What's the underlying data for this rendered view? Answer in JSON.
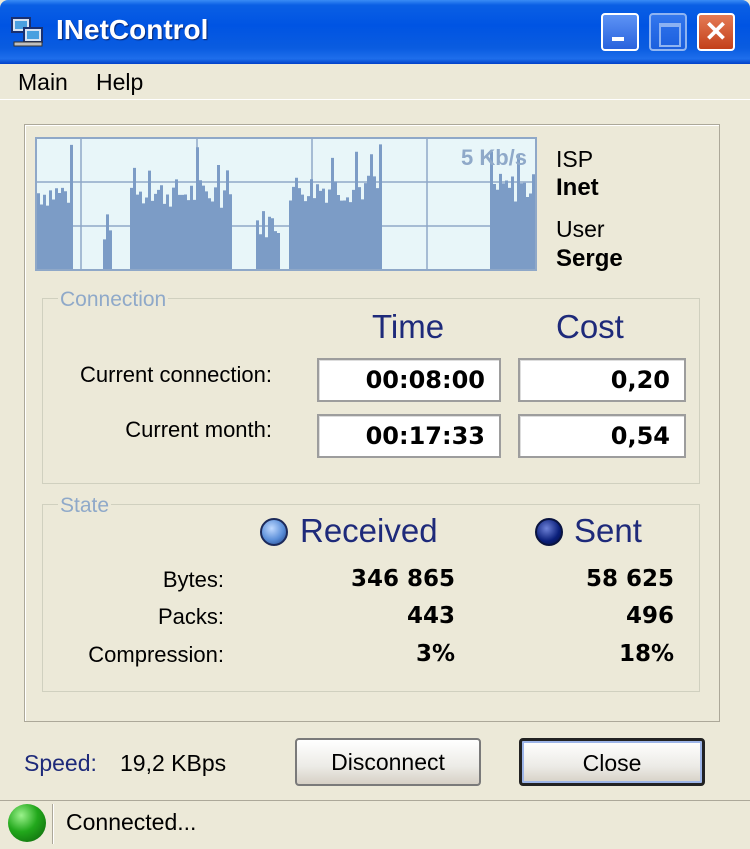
{
  "window": {
    "title": "INetControl"
  },
  "menu": [
    {
      "label": "Main"
    },
    {
      "label": "Help"
    }
  ],
  "graph": {
    "rate_label": "5 Kb/s",
    "fill_color": "#7C9CC6",
    "bg_color": "#E8F6F9"
  },
  "account": {
    "isp_label": "ISP",
    "isp_value": "Inet",
    "user_label": "User",
    "user_value": "Serge"
  },
  "connection": {
    "group_title": "Connection",
    "time_header": "Time",
    "cost_header": "Cost",
    "rows": [
      {
        "label": "Current connection:",
        "time": "00:08:00",
        "cost": "0,20"
      },
      {
        "label": "Current month:",
        "time": "00:17:33",
        "cost": "0,54"
      }
    ]
  },
  "state": {
    "group_title": "State",
    "received_header": "Received",
    "sent_header": "Sent",
    "received_color": "#5B8FD9",
    "sent_color": "#0A1F7A",
    "rows": [
      {
        "label": "Bytes:",
        "received": "346 865",
        "sent": "58 625"
      },
      {
        "label": "Packs:",
        "received": "443",
        "sent": "496"
      },
      {
        "label": "Compression:",
        "received": "3%",
        "sent": "18%"
      }
    ]
  },
  "footer": {
    "speed_label": "Speed:",
    "speed_value": "19,2 KBps",
    "disconnect_label": "Disconnect",
    "close_label": "Close"
  },
  "status": {
    "text": "Connected...",
    "led_color": "#22A81C"
  }
}
